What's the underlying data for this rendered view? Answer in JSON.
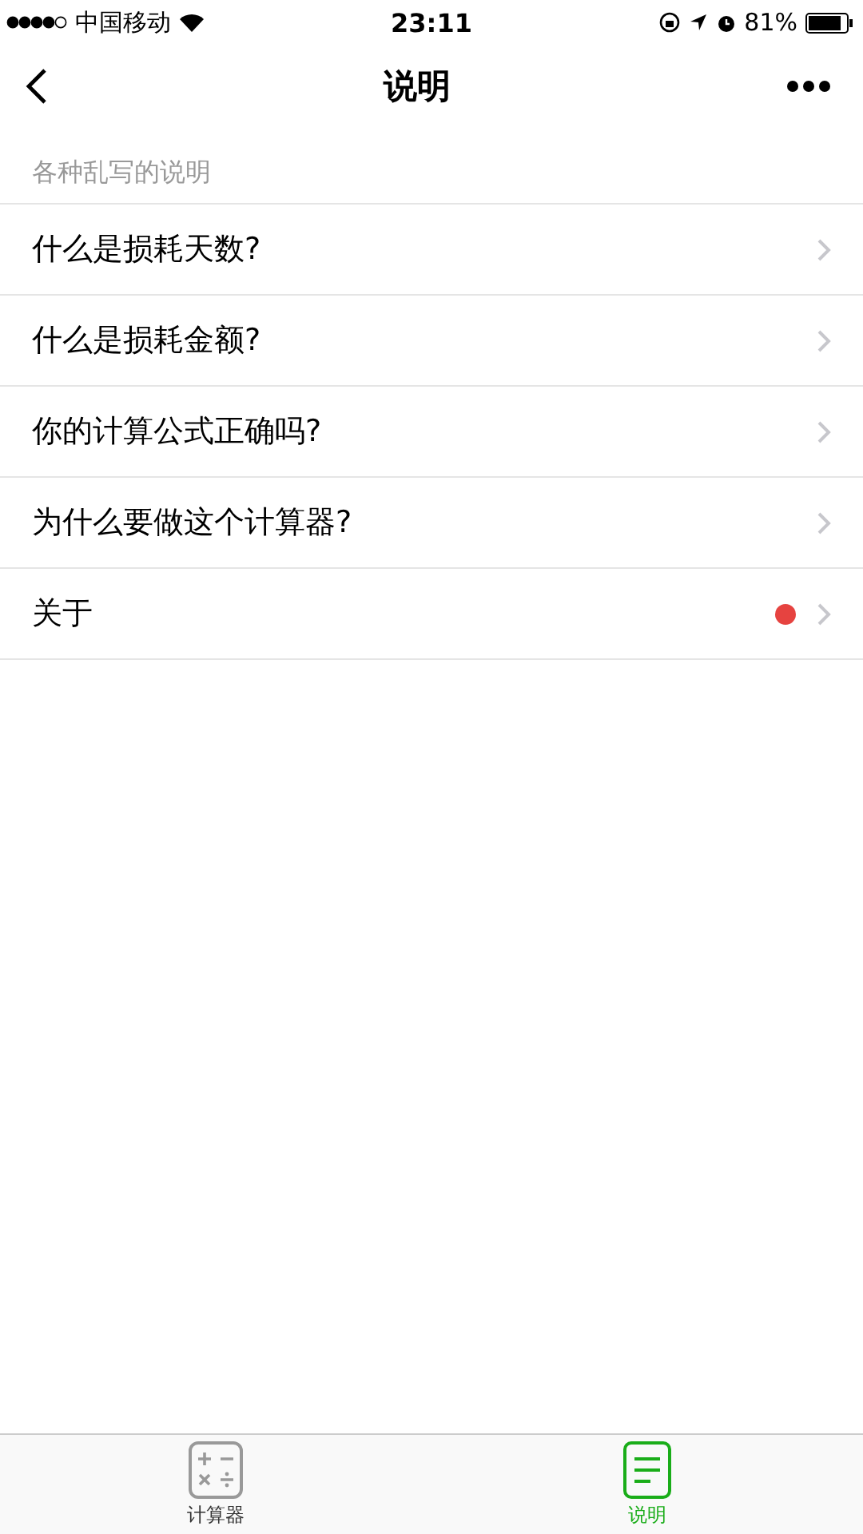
{
  "status_bar": {
    "carrier": "中国移动",
    "time": "23:11",
    "battery": "81%"
  },
  "nav": {
    "title": "说明"
  },
  "section": {
    "header": "各种乱写的说明"
  },
  "items": [
    {
      "label": "什么是损耗天数?",
      "dot": false
    },
    {
      "label": "什么是损耗金额?",
      "dot": false
    },
    {
      "label": "你的计算公式正确吗?",
      "dot": false
    },
    {
      "label": "为什么要做这个计算器?",
      "dot": false
    },
    {
      "label": "关于",
      "dot": true
    }
  ],
  "tabs": [
    {
      "label": "计算器",
      "kind": "calculator",
      "selected": false
    },
    {
      "label": "说明",
      "kind": "document",
      "selected": true
    }
  ]
}
